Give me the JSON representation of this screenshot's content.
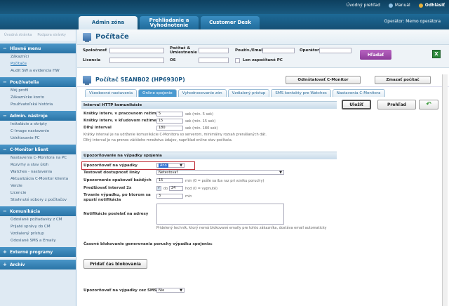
{
  "toplinks": {
    "link1": "Úvodný prehľad",
    "link2": "Manuál",
    "link3": "Odhlásiť"
  },
  "tabs": [
    "Admin zóna",
    "Prehliadanie a Vyhodnotenie",
    "Customer Desk"
  ],
  "operator": "Operátor: Memo operátora",
  "sidebar": {
    "quick1": "Úvodná stránka",
    "quick2": "Podpora stránky",
    "sections": [
      {
        "title": "Hlavné menu",
        "items": [
          "Zákazníci",
          "Počítače",
          "Audit SW a evidencia HW"
        ],
        "active": 1
      },
      {
        "title": "Používatelia",
        "items": [
          "Môj profil",
          "Zákaznícke konto",
          "Používateľská história"
        ]
      },
      {
        "title": "Admin. nástroje",
        "items": [
          "Inštalácie a skripty",
          "C-Image nastavenie",
          "Udržiavanie PC"
        ]
      },
      {
        "title": "C-Monitor klient",
        "items": [
          "Nastavenia C-Monitora na PC",
          "Rozvrhy a stav úloh",
          "Watches - nastavenia",
          "Aktualizácia C-Monitor klienta",
          "Verzie",
          "Licencie",
          "Stiahnuté súbory z počítačov"
        ]
      },
      {
        "title": "Komunikácia",
        "items": [
          "Odoslané požiadavky z CM",
          "Prijaté správy do CM",
          "Vzdialený prístup",
          "Odoslané SMS a Emaily"
        ]
      },
      {
        "title": "Externé programy",
        "items": []
      },
      {
        "title": "Archív",
        "items": []
      }
    ]
  },
  "page": {
    "title": "Počítače"
  },
  "filter": {
    "spolocnost": "Spoločnosť",
    "pocitac": "Počítač & Umiestnenie",
    "email": "Použív./Email",
    "operator": "Operátor",
    "licencia": "Licencia",
    "os": "OS",
    "checkbox": "Len započítané PC",
    "search": "Hľadať",
    "excel": "X"
  },
  "detail": {
    "title": "Počítač SEANB02 (HP6930P)",
    "btn_odinstal": "Odinštalovať C-Monitor",
    "btn_zmazat": "Zmazať počítač",
    "btn_ulozit": "Uložiť",
    "btn_prehlad": "Prehľad",
    "tabs": [
      "Všeobecné nastavenia",
      "Online spojenie",
      "Vyhodnocovanie zón",
      "Vzdialený prístup",
      "SMS kontakty pre Watches",
      "Nastavenia C-Monitora"
    ],
    "active_tab": 1
  },
  "interval": {
    "header": "Interval HTTP komunikácie",
    "r1_label": "Krátky interv. v pracovnom režime",
    "r1_value": "5",
    "r1_note": "sek (min. 5 sek)",
    "r2_label": "Krátky interv. v kľudovom režime",
    "r2_value": "15",
    "r2_note": "sek (min. 15 sek)",
    "r3_label": "Dlhý interval",
    "r3_value": "180",
    "r3_note": "sek (min. 180 sek)",
    "desc1": "Krátky interval je na udržanie komunikácie C-Monitora so serverom, minimálny rozsah prenášaných dát.",
    "desc2": "Dlhý interval je na prenos väčšieho množstva údajov, napríklad online stav počítača."
  },
  "alerts": {
    "header": "Upozorňovanie na výpadky spojenia",
    "a1_label": "Upozorňovať na výpadky",
    "a1_value": "Áno",
    "a2_label": "Testovať dostupnosť linky",
    "a2_value": "Netestovať",
    "a3_label": "Upozornenie opakovať každých",
    "a3_value": "15",
    "a3_note": "min (0 = pošle sa iba raz pri vzniku poruchy)",
    "a4_label": "Predlžovať interval 2x",
    "a4_do": "do",
    "a4_value": "24",
    "a4_note": "hod (0 = vypnuté)",
    "a5_label": "Trvanie výpadku, po ktorom sa spustí notifikácia",
    "a5_value": "3",
    "a5_note": "min",
    "a6_label": "Notifikácie posielať na adresy",
    "a6_note": "Pridelený technik, ktorý nemá blokované emaily pre tohto zákazníka, dostáva email automaticky",
    "block_header": "Časové blokovanie generovania poruchy výpadku spojenia:",
    "block_btn": "Pridať čas blokovania",
    "sms_label": "Upozorňovať na výpadky cez SMS",
    "sms_value": "Nie"
  }
}
